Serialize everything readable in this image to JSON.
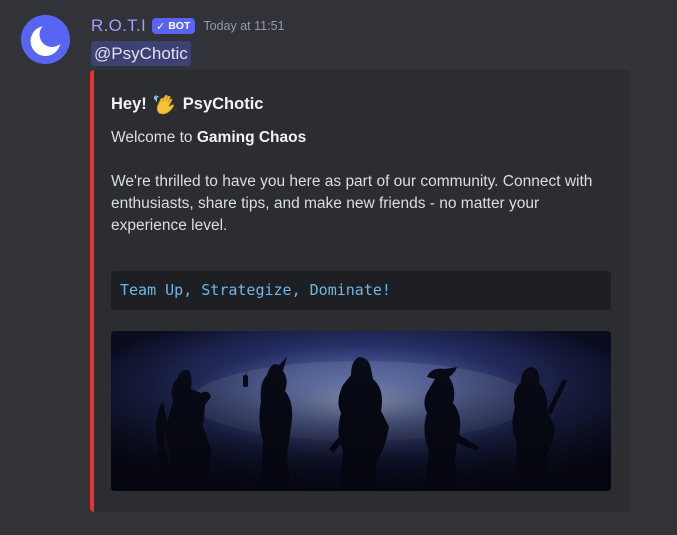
{
  "message": {
    "username": "R.O.T.I",
    "bot_tag": {
      "check_glyph": "✓",
      "label": "BOT"
    },
    "timestamp": "Today at 11:51",
    "mention": "@PsyChotic"
  },
  "embed": {
    "accent_color": "#ed2f2f",
    "title_prefix": "Hey!",
    "title_icon": "waving-hand-icon",
    "title_name": "PsyChotic",
    "welcome_prefix": "Welcome to ",
    "welcome_server": "Gaming Chaos",
    "body": "We're thrilled to have you here as part of our community. Connect with enthusiasts, share tips, and make new friends - no matter your experience level.",
    "code": "Team Up, Strategize, Dominate!"
  },
  "colors": {
    "background": "#313338",
    "embed_background": "#2b2d31",
    "username": "#a29bfe",
    "bot_tag": "#5865f2",
    "mention_background": "#3e4270",
    "code_text": "#6bb7e8"
  }
}
